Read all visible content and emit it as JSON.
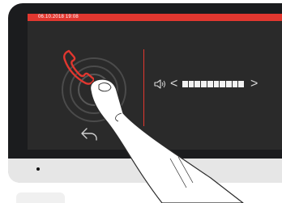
{
  "status_bar": {
    "datetime": "06.10.2018  19:08"
  },
  "volume": {
    "level_fraction": 1.0,
    "segments": 10
  },
  "icons": {
    "call": "phone-handset-icon",
    "back": "back-arrow-icon",
    "speaker": "speaker-icon",
    "decrease": "chevron-left-icon",
    "increase": "chevron-right-icon"
  },
  "colors": {
    "accent": "#e2372f",
    "screen": "#2a2a2a",
    "bezel": "#1b1c1e"
  },
  "glyphs": {
    "chev_left": "<",
    "chev_right": ">"
  }
}
